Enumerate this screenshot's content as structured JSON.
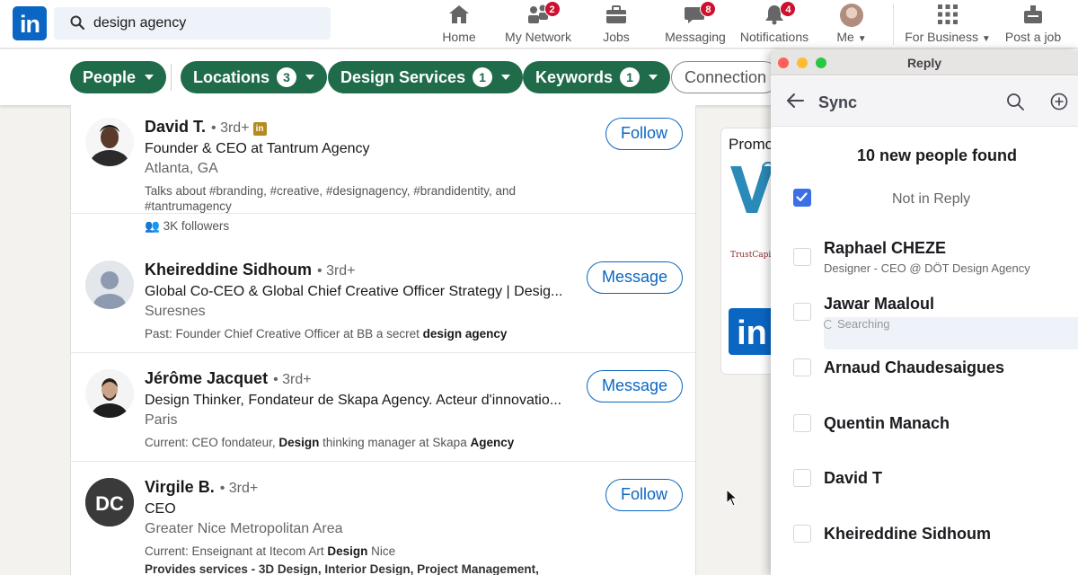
{
  "topnav": {
    "logo": "in",
    "search_query": "design agency",
    "items": [
      {
        "label": "Home",
        "icon": "home-icon"
      },
      {
        "label": "My Network",
        "icon": "network-icon",
        "badge": "2"
      },
      {
        "label": "Jobs",
        "icon": "briefcase-icon"
      },
      {
        "label": "Messaging",
        "icon": "messaging-icon",
        "badge": "8"
      },
      {
        "label": "Notifications",
        "icon": "bell-icon",
        "badge": "4"
      },
      {
        "label": "Me",
        "icon": "avatar"
      },
      {
        "label": "For Business",
        "icon": "grid-icon"
      },
      {
        "label": "Post a job",
        "icon": "post-job-icon"
      }
    ]
  },
  "filters": {
    "people": "People",
    "locations": "Locations",
    "locations_count": "3",
    "design_services": "Design Services",
    "design_services_count": "1",
    "keywords": "Keywords",
    "keywords_count": "1",
    "connections": "Connection"
  },
  "results": [
    {
      "name": "David T.",
      "degree": "• 3rd+",
      "headline": "Founder & CEO at Tantrum Agency",
      "location": "Atlanta, GA",
      "snippet": "Talks about #branding, #creative, #designagency, #brandidentity, and #tantrumagency",
      "followers": "3K followers",
      "action": "Follow"
    },
    {
      "name": "Kheireddine Sidhoum",
      "degree": "• 3rd+",
      "headline": "Global Co-CEO & Global Chief Creative Officer Strategy | Desig...",
      "location": "Suresnes",
      "snippet_prefix": "Past: Founder Chief Creative Officer at BB a secret ",
      "snippet_bold": "design agency",
      "action": "Message"
    },
    {
      "name": "Jérôme Jacquet",
      "degree": "• 3rd+",
      "headline": "Design Thinker, Fondateur de Skapa Agency. Acteur d'innovatio...",
      "location": "Paris",
      "snippet_a": "Current: CEO fondateur, ",
      "snippet_b": "Design",
      "snippet_c": " thinking manager at Skapa ",
      "snippet_d": "Agency",
      "action": "Message"
    },
    {
      "name": "Virgile B.",
      "degree": "• 3rd+",
      "headline": "CEO",
      "location": "Greater Nice Metropolitan Area",
      "snippet_a": "Current: Enseignant at Itecom Art ",
      "snippet_b": "Design",
      "snippet_c": " Nice",
      "snippet2": "Provides services - 3D Design, Interior Design, Project Management,",
      "avatar_text": "DC",
      "action": "Follow"
    }
  ],
  "promo": {
    "label": "Promo",
    "trust": "TrustCapital",
    "logo": "in"
  },
  "reply_window": {
    "title": "Reply",
    "header": "Sync",
    "found": "10 new people found",
    "not_in_reply": "Not in Reply",
    "people": [
      {
        "name": "Raphael CHEZE",
        "sub": "Designer - CEO @ DÖT Design Agency"
      },
      {
        "name": "Jawar Maaloul",
        "sub": "Searching"
      },
      {
        "name": "Arnaud Chaudesaigues",
        "sub": ""
      },
      {
        "name": "Quentin Manach",
        "sub": ""
      },
      {
        "name": "David T",
        "sub": ""
      },
      {
        "name": "Kheireddine Sidhoum",
        "sub": ""
      }
    ]
  },
  "colors": {
    "linkedin_blue": "#0a66c2",
    "filter_green": "#1f6b4a",
    "badge_red": "#cb112d",
    "checkbox_blue": "#3b6fe6"
  }
}
